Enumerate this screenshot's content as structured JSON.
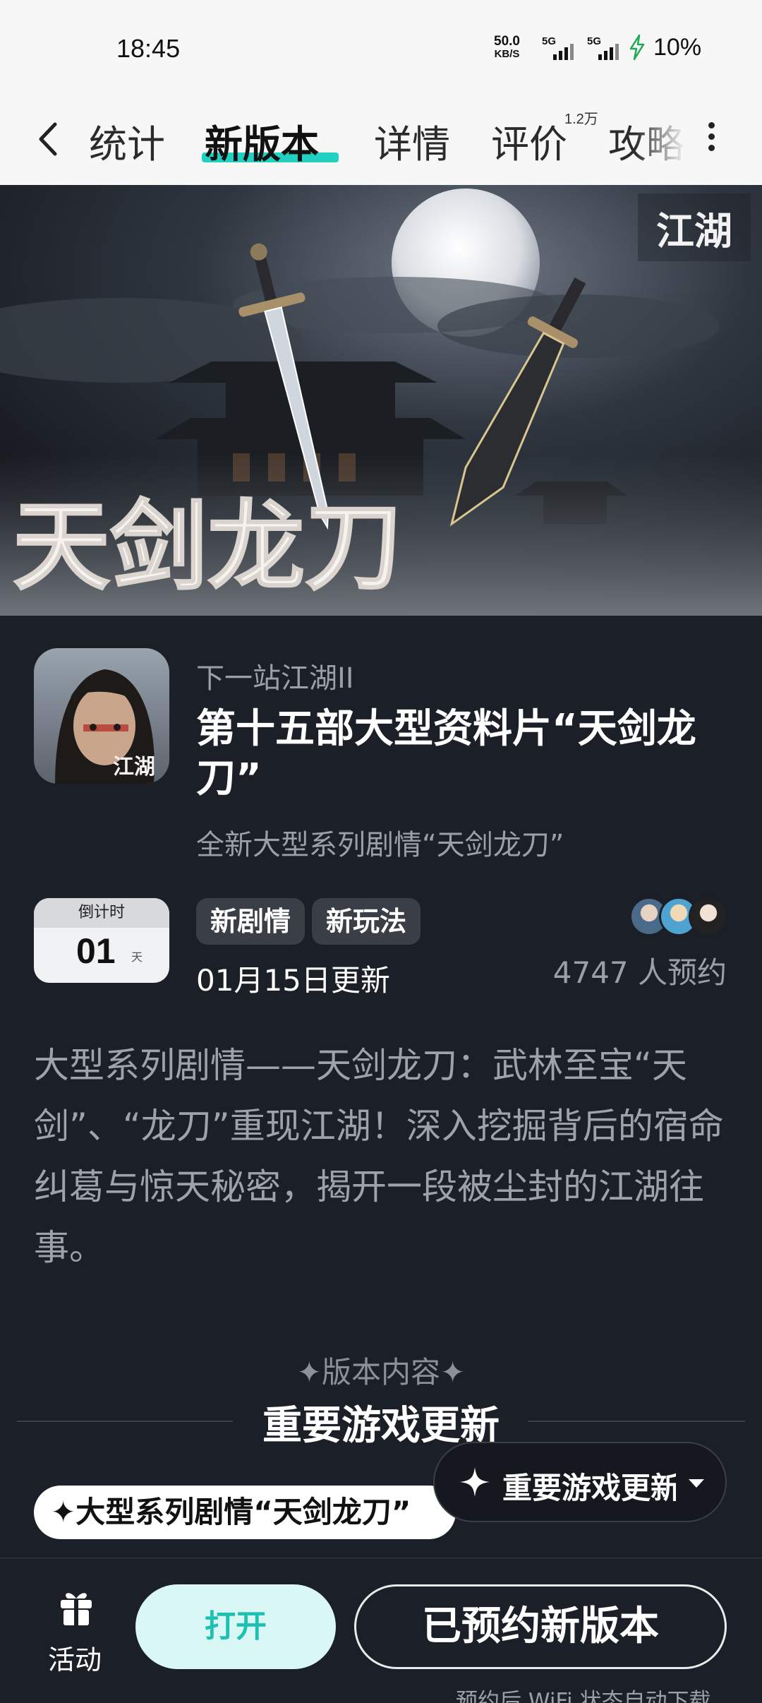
{
  "status_bar": {
    "time": "18:45",
    "net_speed_value": "50.0",
    "net_speed_unit": "KB/S",
    "sim1": "5G",
    "sim2": "5G",
    "battery": "10%"
  },
  "nav": {
    "tabs": [
      "统计",
      "新版本",
      "详情",
      "评价",
      "攻略"
    ],
    "active_tab": "新版本",
    "review_badge": "1.2万",
    "accent_color": "#22d0c2"
  },
  "banner": {
    "logo_text": "江湖",
    "title_art": "天剑龙刀"
  },
  "header": {
    "app_icon_text": "江湖",
    "app_name": "下一站江湖II",
    "title": "第十五部大型资料片“天剑龙刀”",
    "subtitle": "全新大型系列剧情“天剑龙刀”"
  },
  "countdown": {
    "label": "倒计时",
    "value": "01",
    "unit": "天"
  },
  "tags": [
    "新剧情",
    "新玩法"
  ],
  "update_date": "01月15日更新",
  "reservations": "4747 人预约",
  "description": "大型系列剧情——天剑龙刀：武林至宝“天剑”、“龙刀”重现江湖！深入挖掘背后的宿命纠葛与惊天秘密，揭开一段被尘封的江湖往事。",
  "section": {
    "label": "✦版本内容✦",
    "title": "重要游戏更新",
    "pill": "✦大型系列剧情“天剑龙刀”",
    "floating_nav": "重要游戏更新"
  },
  "bottom_bar": {
    "activity_label": "活动",
    "open_button": "打开",
    "reserved_button": "已预约新版本",
    "hint": "预约后 WiFi 状态自动下载"
  }
}
